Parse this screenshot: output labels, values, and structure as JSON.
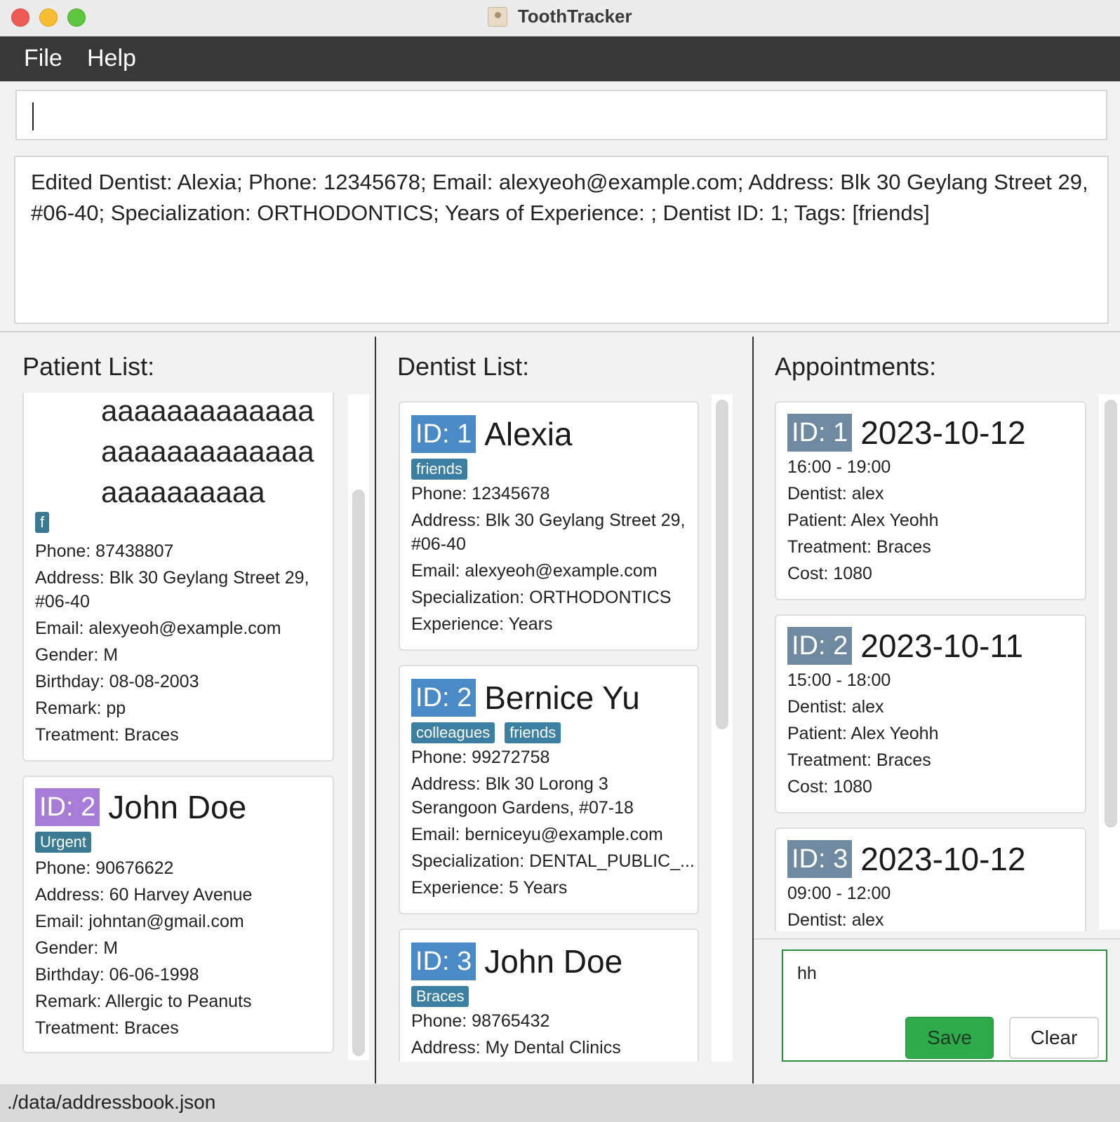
{
  "window": {
    "title": "ToothTracker"
  },
  "menu": {
    "file": "File",
    "help": "Help"
  },
  "command": {
    "value": "",
    "placeholder": ""
  },
  "result": {
    "text": "Edited Dentist: Alexia; Phone: 12345678; Email: alexyeoh@example.com; Address: Blk 30 Geylang Street 29, #06-40; Specialization: ORTHODONTICS; Years of Experience: ; Dentist ID: 1; Tags: [friends]"
  },
  "patients": {
    "title": "Patient List:",
    "cards": [
      {
        "name_lines": [
          "aaaaaaaaaaaaa",
          "aaaaaaaaaaaaa",
          "aaaaaaaaaa"
        ],
        "tags": [
          "f"
        ],
        "phone": "Phone: 87438807",
        "address_1": "Address: Blk 30 Geylang Street 29,",
        "address_2": "#06-40",
        "email": "Email: alexyeoh@example.com",
        "gender": "Gender: M",
        "birthday": "Birthday: 08-08-2003",
        "remark": "Remark: pp",
        "treatment": "Treatment: Braces"
      },
      {
        "id": "ID: 2",
        "name": "John Doe",
        "tags": [
          "Urgent"
        ],
        "phone": "Phone: 90676622",
        "address": "Address: 60 Harvey Avenue",
        "email": "Email: johntan@gmail.com",
        "gender": "Gender: M",
        "birthday": "Birthday: 06-06-1998",
        "remark": "Remark: Allergic to Peanuts",
        "treatment": "Treatment: Braces"
      }
    ]
  },
  "dentists": {
    "title": "Dentist List:",
    "cards": [
      {
        "id": "ID: 1",
        "name": "Alexia",
        "tags": [
          "friends"
        ],
        "phone": "Phone: 12345678",
        "address_1": "Address: Blk 30 Geylang Street 29,",
        "address_2": "#06-40",
        "email": "Email: alexyeoh@example.com",
        "specialization": "Specialization: ORTHODONTICS",
        "experience": "Experience:  Years"
      },
      {
        "id": "ID: 2",
        "name": "Bernice Yu",
        "tags": [
          "colleagues",
          "friends"
        ],
        "phone": "Phone: 99272758",
        "address_1": "Address: Blk 30 Lorong 3",
        "address_2": "Serangoon Gardens, #07-18",
        "email": "Email: berniceyu@example.com",
        "specialization": "Specialization: DENTAL_PUBLIC_...",
        "experience": "Experience: 5 Years"
      },
      {
        "id": "ID: 3",
        "name": "John Doe",
        "tags": [
          "Braces"
        ],
        "phone": "Phone: 98765432",
        "address_1": "Address: My Dental Clinics"
      }
    ]
  },
  "appointments": {
    "title": "Appointments:",
    "cards": [
      {
        "id": "ID: 1",
        "date": "2023-10-12",
        "time": "16:00 - 19:00",
        "dentist": "Dentist: alex",
        "patient": "Patient: Alex Yeohh",
        "treatment": "Treatment: Braces",
        "cost": "Cost: 1080"
      },
      {
        "id": "ID: 2",
        "date": "2023-10-11",
        "time": "15:00 - 18:00",
        "dentist": "Dentist: alex",
        "patient": "Patient: Alex Yeohh",
        "treatment": "Treatment: Braces",
        "cost": "Cost: 1080"
      },
      {
        "id": "ID: 3",
        "date": "2023-10-12",
        "time": "09:00 - 12:00",
        "dentist": "Dentist: alex"
      }
    ]
  },
  "note": {
    "text": "hh",
    "save_label": "Save",
    "clear_label": "Clear"
  },
  "status": {
    "path": "./data/addressbook.json"
  },
  "colors": {
    "menubar": "#383838",
    "id_blue": "#4a8ac6",
    "id_purple": "#a77bd8",
    "id_gray": "#6f8aa0",
    "tag": "#3b7fa3",
    "save": "#2eaa4a"
  }
}
